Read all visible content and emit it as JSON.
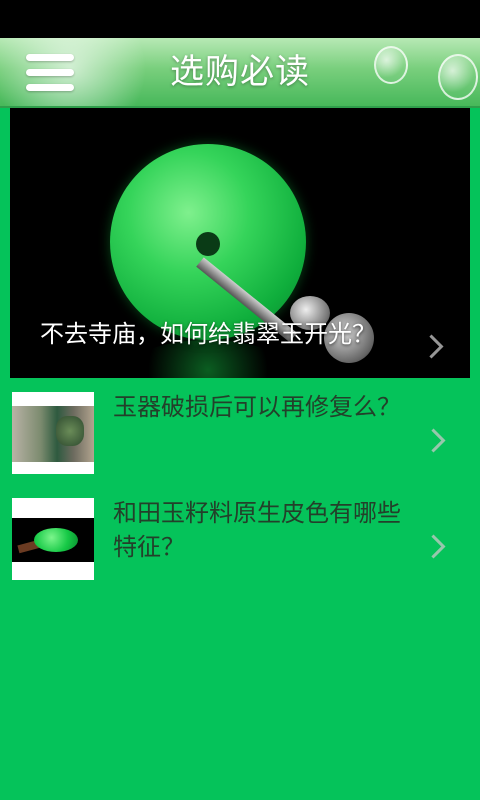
{
  "header": {
    "title": "选购必读",
    "menu_icon": "hamburger-menu-icon",
    "background_color": "#79cf7d"
  },
  "featured": {
    "title": "不去寺庙，如何给翡翠玉开光？",
    "image": "green-jade-disc-pendant"
  },
  "articles": [
    {
      "title": "玉器破损后可以再修复么？",
      "thumbnail": "broken-jade-carving-thumbnail"
    },
    {
      "title": "和田玉籽料原生皮色有哪些特征？",
      "thumbnail": "green-jade-pebble-thumbnail"
    }
  ],
  "theme": {
    "page_background": "#05c35a",
    "text_color": "#23402a"
  }
}
